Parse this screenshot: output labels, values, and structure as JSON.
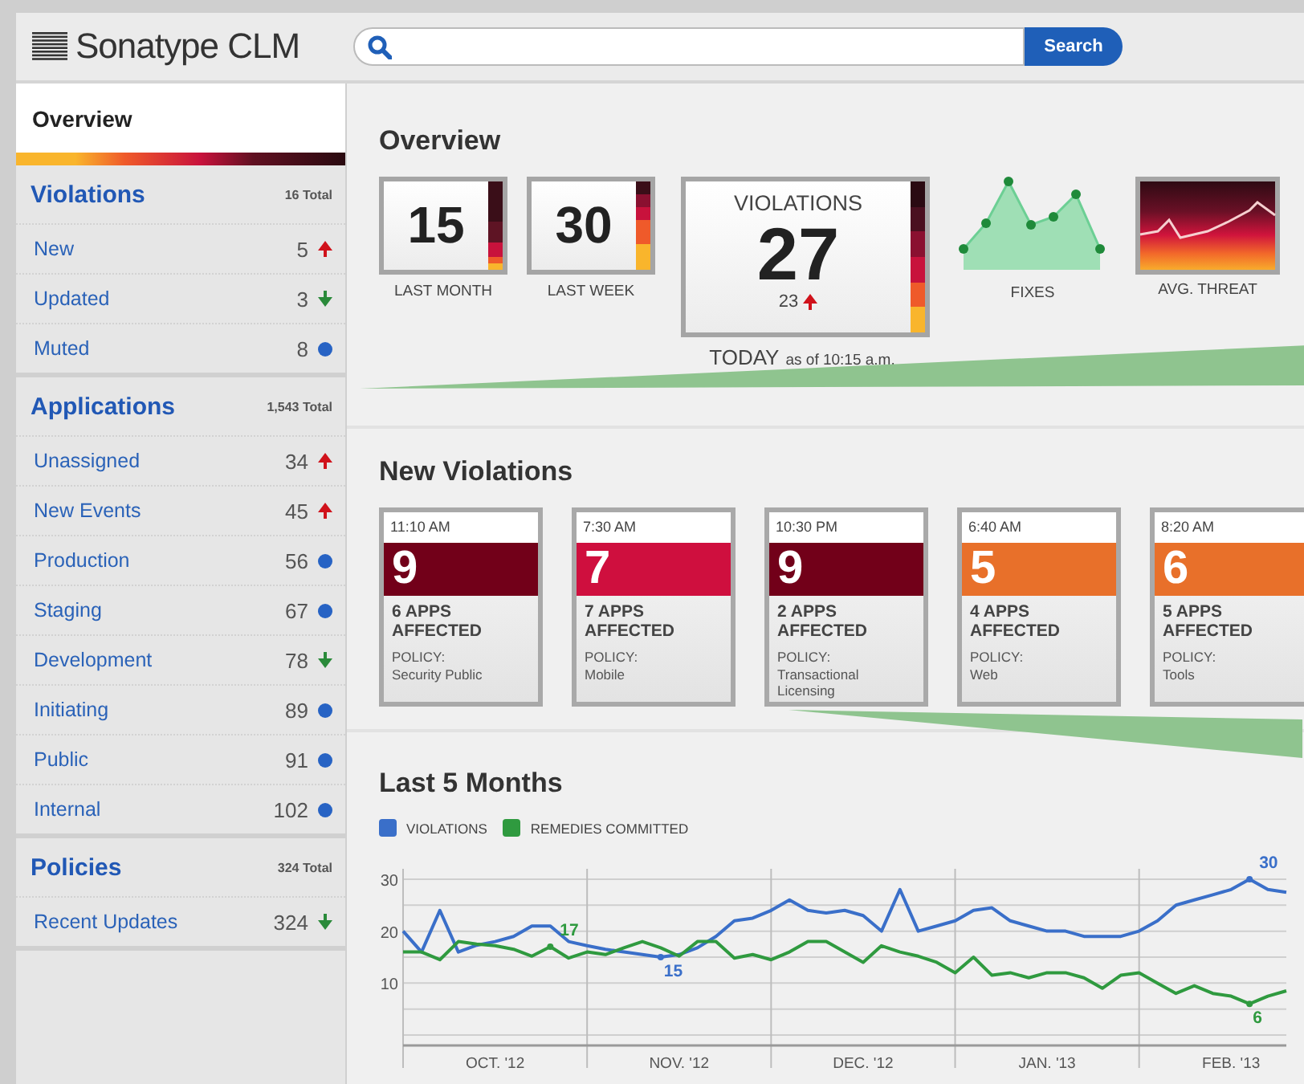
{
  "header": {
    "logo": "Sonatype CLM",
    "search_button": "Search"
  },
  "sidebar": {
    "tab": {
      "label": "Overview",
      "selected": true
    },
    "sections": [
      {
        "title": "Violations",
        "total": "16 Total",
        "items": [
          {
            "label": "New",
            "count": "5",
            "kind": "up"
          },
          {
            "label": "Updated",
            "count": "3",
            "kind": "down"
          },
          {
            "label": "Muted",
            "count": "8",
            "kind": "steady"
          }
        ]
      },
      {
        "title": "Applications",
        "total": "1,543 Total",
        "items": [
          {
            "label": "Unassigned",
            "count": "34",
            "kind": "up"
          },
          {
            "label": "New Events",
            "count": "45",
            "kind": "up"
          },
          {
            "label": "Production",
            "count": "56",
            "kind": "steady"
          },
          {
            "label": "Staging",
            "count": "67",
            "kind": "steady"
          },
          {
            "label": "Development",
            "count": "78",
            "kind": "down"
          },
          {
            "label": "Initiating",
            "count": "89",
            "kind": "steady"
          },
          {
            "label": "Public",
            "count": "91",
            "kind": "steady"
          },
          {
            "label": "Internal",
            "count": "102",
            "kind": "steady"
          }
        ]
      },
      {
        "title": "Policies",
        "total": "324 Total",
        "items": [
          {
            "label": "Recent Updates",
            "count": "324",
            "kind": "down"
          }
        ]
      }
    ]
  },
  "overview": {
    "title": "Overview",
    "stats": [
      {
        "value": "15",
        "label": "LAST MONTH"
      },
      {
        "value": "30",
        "label": "LAST WEEK"
      }
    ],
    "today": {
      "title": "VIOLATIONS",
      "value": "27",
      "change": {
        "value": "23",
        "kind": "up"
      },
      "caption": "TODAY",
      "as_of": "as of 10:15 a.m."
    },
    "fixes": {
      "label": "FIXES"
    },
    "threat": {
      "label": "AVG. THREAT"
    }
  },
  "new_violations": {
    "title": "New Violations",
    "cards": [
      {
        "time": "11:10 AM",
        "count": "9",
        "color": "#720019",
        "apps": "6 APPS AFFECTED",
        "policy_label": "POLICY:",
        "policy": "Security Public"
      },
      {
        "time": "7:30 AM",
        "count": "7",
        "color": "#cf0f3e",
        "apps": "7 APPS AFFECTED",
        "policy_label": "POLICY:",
        "policy": "Mobile"
      },
      {
        "time": "10:30 PM",
        "count": "9",
        "color": "#720019",
        "apps": "2 APPS AFFECTED",
        "policy_label": "POLICY:",
        "policy": "Transactional Licensing"
      },
      {
        "time": "6:40 AM",
        "count": "5",
        "color": "#e8702a",
        "apps": "4 APPS AFFECTED",
        "policy_label": "POLICY:",
        "policy": "Web"
      },
      {
        "time": "8:20 AM",
        "count": "6",
        "color": "#e8702a",
        "apps": "5 APPS AFFECTED",
        "policy_label": "POLICY:",
        "policy": "Tools"
      }
    ]
  },
  "last_months": {
    "title": "Last 5 Months",
    "chart_data": {
      "type": "line",
      "categories": [
        null,
        null,
        null,
        null,
        null,
        "OCT. '12",
        null,
        null,
        null,
        null,
        null,
        null,
        null,
        null,
        null,
        "NOV. '12",
        null,
        null,
        null,
        null,
        null,
        null,
        null,
        null,
        null,
        "DEC. '12",
        null,
        null,
        null,
        null,
        null,
        null,
        null,
        null,
        null,
        "JAN. '13",
        null,
        null,
        null,
        null,
        null,
        null,
        null,
        null,
        null,
        "FEB. '13",
        null,
        null,
        null
      ],
      "series": [
        {
          "name": "VIOLATIONS",
          "color": "#3a6fc9",
          "values": [
            20,
            16,
            24,
            16,
            17.3,
            18,
            19,
            21,
            21,
            18,
            17.2,
            16.5,
            16,
            15.5,
            15,
            15.5,
            16.8,
            19,
            22,
            22.5,
            24,
            26,
            24,
            23.5,
            24,
            23,
            20,
            28,
            20,
            21,
            22,
            24,
            24.5,
            22,
            21,
            20,
            20,
            19,
            19,
            19,
            20,
            22,
            25,
            26,
            27,
            28,
            30,
            28,
            27.5
          ]
        },
        {
          "name": "REMEDIES COMMITTED",
          "color": "#2f9a3f",
          "values": [
            16,
            16,
            14.5,
            18,
            17.5,
            17.2,
            16.5,
            15.2,
            17,
            14.8,
            16,
            15.5,
            16.8,
            18,
            16.8,
            15.2,
            18,
            18,
            14.8,
            15.5,
            14.5,
            16,
            18,
            18,
            16,
            14,
            17.2,
            16,
            15.2,
            14,
            12,
            15,
            11.5,
            12,
            11,
            12,
            12,
            11,
            9,
            11.5,
            12,
            10,
            8,
            9.5,
            8,
            7.5,
            6,
            7.5,
            8.5
          ]
        }
      ],
      "ylim": [
        -2,
        32
      ],
      "yticks": [
        10,
        20,
        30
      ],
      "grid": true,
      "annotations": [
        {
          "y": 17,
          "text": "17"
        },
        {
          "y": 15,
          "text": "15"
        },
        {
          "y": 30,
          "text": "30"
        },
        {
          "y": 6,
          "text": "6"
        }
      ]
    }
  }
}
